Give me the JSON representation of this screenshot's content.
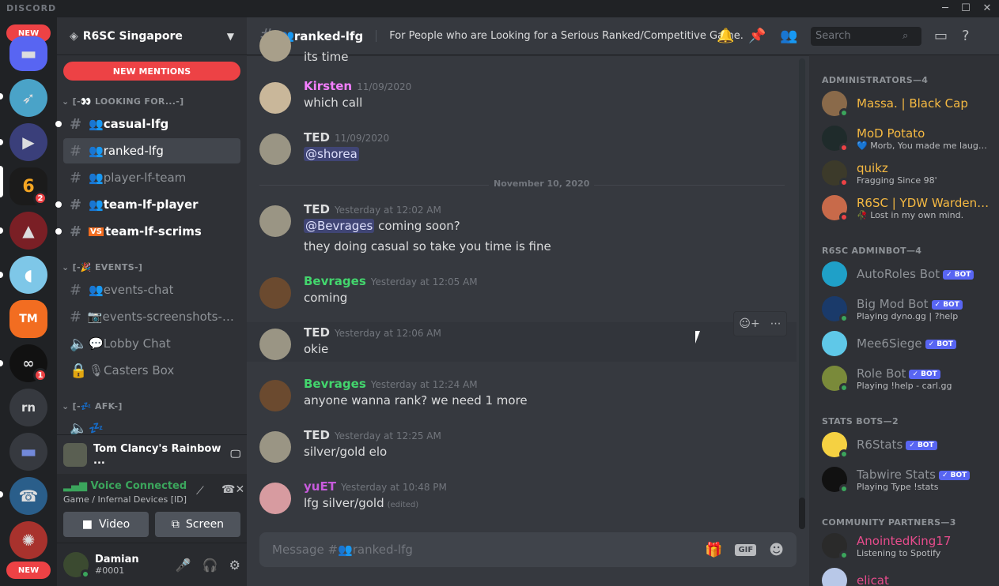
{
  "app": {
    "brand": "DISCORD"
  },
  "rail": {
    "new_top": "NEW",
    "new_bottom": "NEW",
    "badge_r6": "2",
    "badge_div": "1",
    "rn": "rn"
  },
  "guild": {
    "name": "R6SC Singapore",
    "new_mentions": "NEW MENTIONS"
  },
  "categories": {
    "looking": "[-👀 LOOKING FOR...-]",
    "events": "[-🎉 EVENTS-]",
    "afk": "[-💤 AFK-]"
  },
  "channels": {
    "casual": "casual-lfg",
    "ranked": "ranked-lfg",
    "player_lf_team": "player-lf-team",
    "team_lf_player": "team-lf-player",
    "team_lf_scrims": "team-lf-scrims",
    "events_chat": "events-chat",
    "events_screens": "events-screenshots-p...",
    "lobby": "Lobby Chat",
    "casters": "Casters Box",
    "afk_voice": "💤"
  },
  "activity": {
    "game": "Tom Clancy's Rainbow ..."
  },
  "voice": {
    "status": "Voice Connected",
    "sub": "Game / Infernal Devices [ID]",
    "video": "Video",
    "screen": "Screen"
  },
  "user": {
    "name": "Damian",
    "tag": "#0001"
  },
  "header": {
    "channel": "ranked-lfg",
    "topic": "For People who are Looking for a Serious Ranked/Competitive Game.",
    "search_placeholder": "Search"
  },
  "messages": [
    {
      "author": "Kirsten",
      "time": "11/09/2020",
      "text": "which call",
      "color": "#f47fff"
    },
    {
      "author": "TED",
      "time": "11/09/2020",
      "mention": "@shorea",
      "color": "#dcddde"
    },
    {
      "author": "TED",
      "time": "Yesterday at 12:02 AM",
      "mention": "@Bevrages",
      "text": " coming soon?",
      "text2": "they doing casual so take you time is fine",
      "color": "#dcddde"
    },
    {
      "author": "Bevrages",
      "time": "Yesterday at 12:05 AM",
      "text": "coming",
      "color": "#43d66d"
    },
    {
      "author": "TED",
      "time": "Yesterday at 12:06 AM",
      "text": "okie",
      "color": "#dcddde"
    },
    {
      "author": "Bevrages",
      "time": "Yesterday at 12:24 AM",
      "text": "anyone wanna rank? we need 1 more",
      "color": "#43d66d"
    },
    {
      "author": "TED",
      "time": "Yesterday at 12:25 AM",
      "text": "silver/gold elo",
      "color": "#dcddde"
    },
    {
      "author": "yuET",
      "time": "Yesterday at 10:48 PM",
      "text": "lfg silver/gold",
      "edited": "(edited)",
      "color": "#c75bdc"
    }
  ],
  "top_partial_text": "its time",
  "date_divider": "November 10, 2020",
  "composer": {
    "placeholder": "Message #👥ranked-lfg"
  },
  "member_groups": {
    "admins": "ADMINISTRATORS—4",
    "adminbot": "R6SC ADMINBOT—4",
    "stats": "STATS BOTS—2",
    "partners": "COMMUNITY PARTNERS—3"
  },
  "members": [
    {
      "name": "Massa. | Black Cap",
      "activity": "",
      "color": "#f5b942"
    },
    {
      "name": "MoD Potato",
      "activity": "💙 Morb, You made me laugh,...",
      "color": "#f5b942"
    },
    {
      "name": "quikz",
      "activity": "Fragging Since 98'",
      "color": "#f5b942"
    },
    {
      "name": "R6SC | YDW Warden |...",
      "activity": "🥀 Lost in my own mind.",
      "color": "#f5b942"
    },
    {
      "name": "AutoRoles Bot",
      "activity": "",
      "color": "#8e9297",
      "bot": "✓ BOT"
    },
    {
      "name": "Big Mod Bot",
      "activity": "Playing dyno.gg | ?help",
      "color": "#8e9297",
      "bot": "✓ BOT"
    },
    {
      "name": "Mee6Siege",
      "activity": "",
      "color": "#8e9297",
      "bot": "✓ BOT"
    },
    {
      "name": "Role Bot",
      "activity": "Playing !help - carl.gg",
      "color": "#8e9297",
      "bot": "✓ BOT"
    },
    {
      "name": "R6Stats",
      "activity": "",
      "color": "#8e9297",
      "bot": "✓ BOT"
    },
    {
      "name": "Tabwire Stats",
      "activity": "Playing Type !stats",
      "color": "#8e9297",
      "bot": "✓ BOT"
    },
    {
      "name": "AnointedKing17",
      "activity": "Listening to Spotify",
      "color": "#e74c8c"
    },
    {
      "name": "elicat",
      "activity": "",
      "color": "#e74c8c"
    }
  ]
}
